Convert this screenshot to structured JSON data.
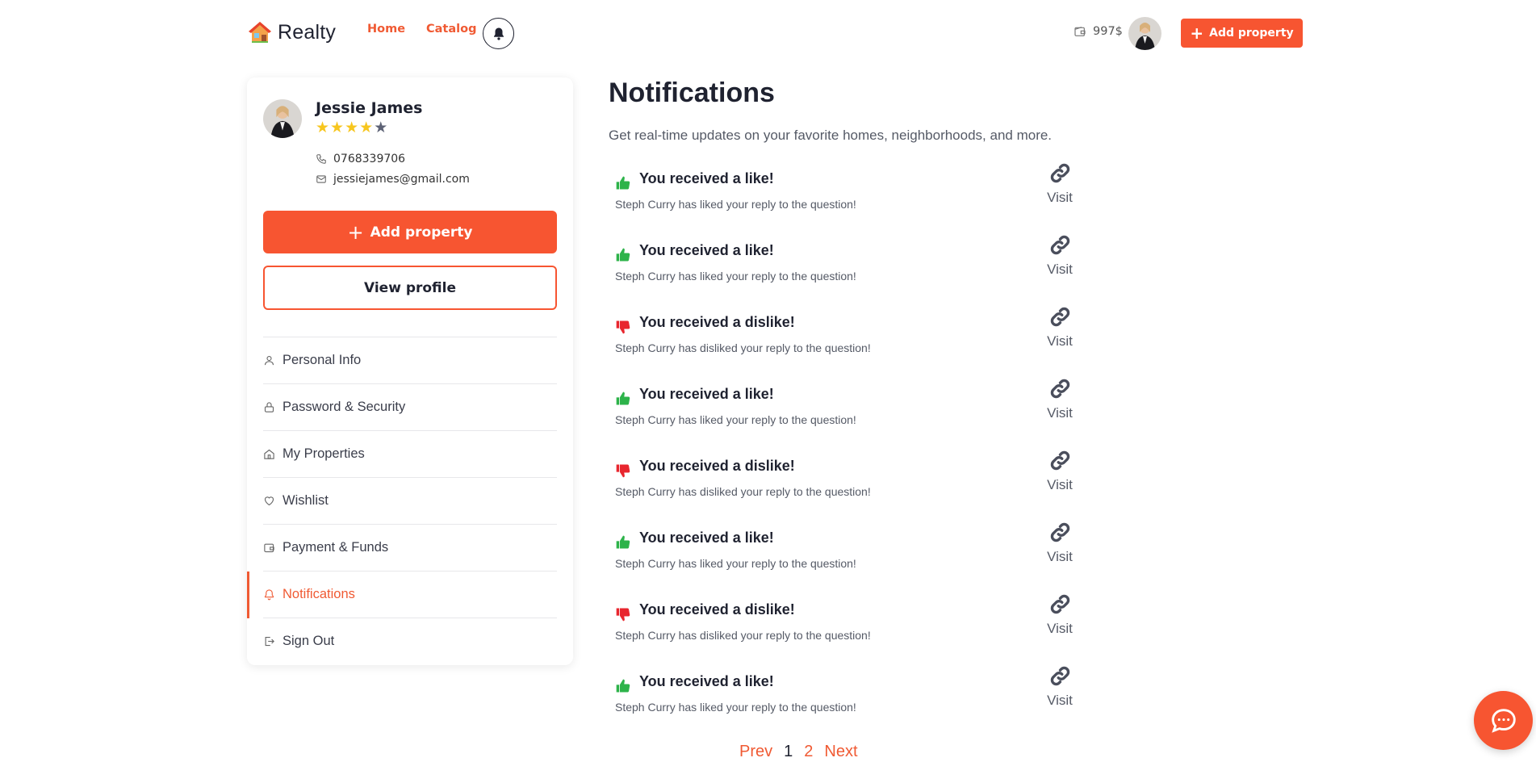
{
  "header": {
    "logo_text": "Realty",
    "nav": [
      {
        "label": "Home"
      },
      {
        "label": "Catalog"
      }
    ],
    "balance": "997$",
    "add_property_label": "Add property"
  },
  "colors": {
    "accent": "#f75531",
    "like": "#2db34a",
    "dislike": "#e8262e",
    "star_on": "#f7c61e",
    "star_off": "#5d6275"
  },
  "profile": {
    "name": "Jessie James",
    "rating": 4,
    "rating_max": 5,
    "phone": "0768339706",
    "email": "jessiejames@gmail.com",
    "add_property_label": "Add property",
    "view_profile_label": "View profile"
  },
  "sidebar": {
    "items": [
      {
        "label": "Personal Info",
        "icon": "user-icon"
      },
      {
        "label": "Password & Security",
        "icon": "lock-icon"
      },
      {
        "label": "My Properties",
        "icon": "home-icon"
      },
      {
        "label": "Wishlist",
        "icon": "heart-icon"
      },
      {
        "label": "Payment & Funds",
        "icon": "wallet-icon"
      },
      {
        "label": "Notifications",
        "icon": "bell-icon",
        "active": true
      },
      {
        "label": "Sign Out",
        "icon": "sign-out-icon"
      }
    ]
  },
  "main": {
    "title": "Notifications",
    "subtitle": "Get real-time updates on your favorite homes, neighborhoods, and more.",
    "visit_label": "Visit",
    "notifications": [
      {
        "type": "like",
        "title": "You received a like!",
        "text": "Steph Curry has liked your reply to the question!"
      },
      {
        "type": "like",
        "title": "You received a like!",
        "text": "Steph Curry has liked your reply to the question!"
      },
      {
        "type": "dislike",
        "title": "You received a dislike!",
        "text": "Steph Curry has disliked your reply to the question!"
      },
      {
        "type": "like",
        "title": "You received a like!",
        "text": "Steph Curry has liked your reply to the question!"
      },
      {
        "type": "dislike",
        "title": "You received a dislike!",
        "text": "Steph Curry has disliked your reply to the question!"
      },
      {
        "type": "like",
        "title": "You received a like!",
        "text": "Steph Curry has liked your reply to the question!"
      },
      {
        "type": "dislike",
        "title": "You received a dislike!",
        "text": "Steph Curry has disliked your reply to the question!"
      },
      {
        "type": "like",
        "title": "You received a like!",
        "text": "Steph Curry has liked your reply to the question!"
      }
    ]
  },
  "pagination": {
    "prev": "Prev",
    "pages": [
      "1",
      "2"
    ],
    "current": "1",
    "next": "Next"
  }
}
